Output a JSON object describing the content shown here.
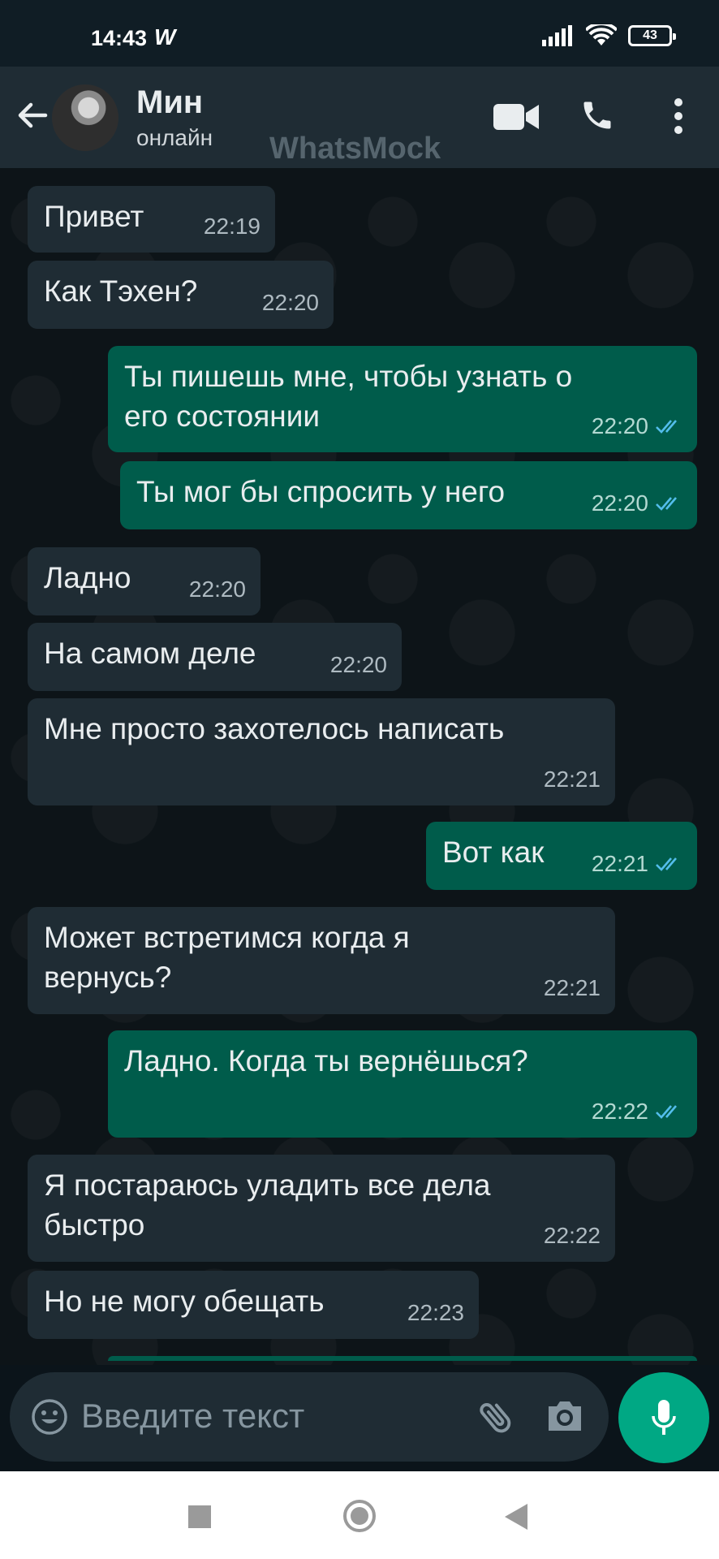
{
  "status_bar": {
    "time": "14:43",
    "carrier_glyph": "W",
    "battery": "43"
  },
  "header": {
    "contact_name": "Мин",
    "contact_status": "онлайн",
    "watermark": "WhatsMock"
  },
  "messages": [
    {
      "dir": "in",
      "text": "Привет",
      "time": "22:19"
    },
    {
      "dir": "in",
      "text": "Как Тэхен?",
      "time": "22:20"
    },
    {
      "dir": "out",
      "text": "Ты пишешь мне, чтобы узнать о\nего состоянии",
      "time": "22:20",
      "read": true
    },
    {
      "dir": "out",
      "text": "Ты мог бы спросить у него",
      "time": "22:20",
      "read": true
    },
    {
      "dir": "in",
      "text": "Ладно",
      "time": "22:20"
    },
    {
      "dir": "in",
      "text": "На самом деле",
      "time": "22:20"
    },
    {
      "dir": "in",
      "text": "Мне просто захотелось написать",
      "time": "22:21"
    },
    {
      "dir": "out",
      "text": "Вот как",
      "time": "22:21",
      "read": true
    },
    {
      "dir": "in",
      "text": "Может встретимся когда я\nвернусь?",
      "time": "22:21"
    },
    {
      "dir": "out",
      "text": "Ладно. Когда ты вернёшься?",
      "time": "22:22",
      "read": true
    },
    {
      "dir": "in",
      "text": "Я постараюсь уладить все дела\nбыстро",
      "time": "22:22"
    },
    {
      "dir": "in",
      "text": "Но не могу обещать",
      "time": "22:23"
    }
  ],
  "composer": {
    "placeholder": "Введите текст"
  },
  "colors": {
    "incoming": "#1f2c34",
    "outgoing": "#005c4b",
    "accent": "#00a884",
    "read_ticks": "#53bdeb"
  }
}
